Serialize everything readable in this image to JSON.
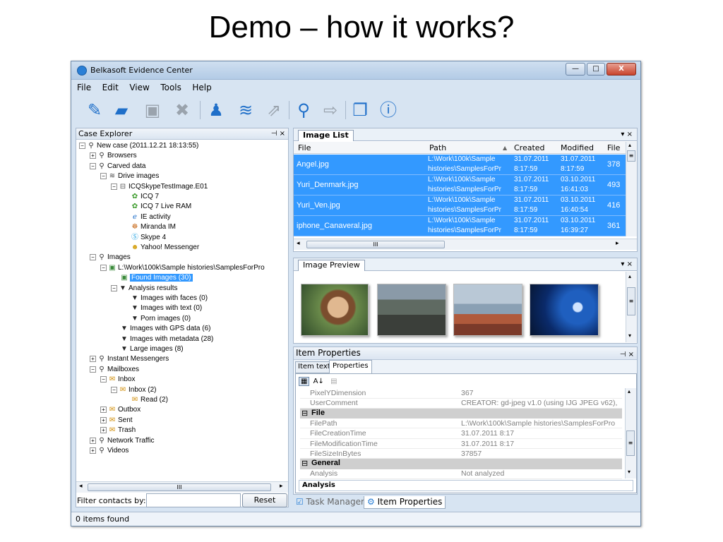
{
  "slide": {
    "title": "Demo – how it works?"
  },
  "window": {
    "title": "Belkasoft Evidence Center",
    "controls": {
      "minimize": "—",
      "maximize": "□",
      "close": "X"
    }
  },
  "menu": [
    "File",
    "Edit",
    "View",
    "Tools",
    "Help"
  ],
  "toolbar": {
    "icons": [
      "edit-icon",
      "open-folder-icon",
      "save-icon",
      "delete-icon",
      "user-icon",
      "layers-icon",
      "export-icon",
      "search-icon",
      "next-icon",
      "copy-icon",
      "info-icon"
    ]
  },
  "case_explorer": {
    "title": "Case Explorer",
    "pin": "⊣",
    "close": "×",
    "tree": [
      {
        "label": "New case (2011.12.21 18:13:55)",
        "level": 0,
        "exp": "−",
        "icon": "search-icon"
      },
      {
        "label": "Browsers",
        "level": 1,
        "exp": "+",
        "icon": "search-icon"
      },
      {
        "label": "Carved data",
        "level": 1,
        "exp": "−",
        "icon": "search-icon"
      },
      {
        "label": "Drive images",
        "level": 2,
        "exp": "−",
        "icon": "layers-icon"
      },
      {
        "label": "ICQSkypeTestImage.E01",
        "level": 3,
        "exp": "−",
        "icon": "disk-icon"
      },
      {
        "label": "ICQ 7",
        "level": 4,
        "exp": "",
        "icon": "icq-icon"
      },
      {
        "label": "ICQ 7 Live RAM",
        "level": 4,
        "exp": "",
        "icon": "icq-icon"
      },
      {
        "label": "IE activity",
        "level": 4,
        "exp": "",
        "icon": "ie-icon"
      },
      {
        "label": "Miranda IM",
        "level": 4,
        "exp": "",
        "icon": "miranda-icon"
      },
      {
        "label": "Skype 4",
        "level": 4,
        "exp": "",
        "icon": "skype-icon"
      },
      {
        "label": "Yahoo! Messenger",
        "level": 4,
        "exp": "",
        "icon": "yahoo-icon"
      },
      {
        "label": "Images",
        "level": 1,
        "exp": "−",
        "icon": "search-icon"
      },
      {
        "label": "L:\\Work\\100k\\Sample histories\\SamplesForPro",
        "level": 2,
        "exp": "−",
        "icon": "image-folder-icon"
      },
      {
        "label": "Found Images (30)",
        "level": 3,
        "exp": "",
        "icon": "image-icon",
        "selected": true
      },
      {
        "label": "Analysis results",
        "level": 3,
        "exp": "−",
        "icon": "filter-icon"
      },
      {
        "label": "Images with faces (0)",
        "level": 4,
        "exp": "",
        "icon": "filter-icon"
      },
      {
        "label": "Images with text (0)",
        "level": 4,
        "exp": "",
        "icon": "filter-icon"
      },
      {
        "label": "Porn images (0)",
        "level": 4,
        "exp": "",
        "icon": "filter-icon"
      },
      {
        "label": "Images with GPS data (6)",
        "level": 3,
        "exp": "",
        "icon": "filter-icon"
      },
      {
        "label": "Images with metadata (28)",
        "level": 3,
        "exp": "",
        "icon": "filter-icon"
      },
      {
        "label": "Large images (8)",
        "level": 3,
        "exp": "",
        "icon": "filter-icon"
      },
      {
        "label": "Instant Messengers",
        "level": 1,
        "exp": "+",
        "icon": "search-icon"
      },
      {
        "label": "Mailboxes",
        "level": 1,
        "exp": "−",
        "icon": "search-icon"
      },
      {
        "label": "Inbox",
        "level": 2,
        "exp": "−",
        "icon": "mail-icon"
      },
      {
        "label": "Inbox (2)",
        "level": 3,
        "exp": "−",
        "icon": "mail-icon"
      },
      {
        "label": "Read (2)",
        "level": 4,
        "exp": "",
        "icon": "mail-icon"
      },
      {
        "label": "Outbox",
        "level": 2,
        "exp": "+",
        "icon": "mail-icon"
      },
      {
        "label": "Sent",
        "level": 2,
        "exp": "+",
        "icon": "mail-icon"
      },
      {
        "label": "Trash",
        "level": 2,
        "exp": "+",
        "icon": "mail-icon"
      },
      {
        "label": "Network Traffic",
        "level": 1,
        "exp": "+",
        "icon": "search-icon"
      },
      {
        "label": "Videos",
        "level": 1,
        "exp": "+",
        "icon": "search-icon"
      }
    ],
    "scroll_grip": "III",
    "filter_label": "Filter contacts by:",
    "filter_value": "",
    "reset_label": "Reset"
  },
  "image_list": {
    "tab": "Image List",
    "controls": "▾ ×",
    "columns": [
      "File",
      "Path",
      "Created",
      "Modified",
      "File"
    ],
    "sort_arrow": "▲",
    "rows": [
      {
        "file": "Angel.jpg",
        "path1": "L:\\Work\\100k\\Sample",
        "path2": "histories\\SamplesForPr",
        "c1": "31.07.2011",
        "c2": "8:17:59",
        "m1": "31.07.2011",
        "m2": "8:17:59",
        "size": "378"
      },
      {
        "file": "Yuri_Denmark.jpg",
        "path1": "L:\\Work\\100k\\Sample",
        "path2": "histories\\SamplesForPr",
        "c1": "31.07.2011",
        "c2": "8:17:59",
        "m1": "03.10.2011",
        "m2": "16:41:03",
        "size": "493"
      },
      {
        "file": "Yuri_Ven.jpg",
        "path1": "L:\\Work\\100k\\Sample",
        "path2": "histories\\SamplesForPr",
        "c1": "31.07.2011",
        "c2": "8:17:59",
        "m1": "03.10.2011",
        "m2": "16:40:54",
        "size": "416"
      },
      {
        "file": "iphone_Canaveral.jpg",
        "path1": "L:\\Work\\100k\\Sample",
        "path2": "histories\\SamplesForPr",
        "c1": "31.07.2011",
        "c2": "8:17:59",
        "m1": "03.10.2011",
        "m2": "16:39:27",
        "size": "361"
      }
    ],
    "scroll_grip": "III"
  },
  "image_preview": {
    "tab": "Image Preview",
    "controls": "▾ ×"
  },
  "item_properties": {
    "title": "Item Properties",
    "pin": "⊣",
    "close": "×",
    "tabs": [
      "Item text",
      "Properties"
    ],
    "sort_icon": "↓",
    "sort_label": "A",
    "rows": [
      {
        "type": "row",
        "key": "PixelYDimension",
        "value": "367"
      },
      {
        "type": "row",
        "key": "UserComment",
        "value": "CREATOR: gd-jpeg v1.0 (using IJG JPEG v62),"
      },
      {
        "type": "cat",
        "key": "File",
        "mark": "⊟"
      },
      {
        "type": "row",
        "key": "FilePath",
        "value": "L:\\Work\\100k\\Sample histories\\SamplesForPro"
      },
      {
        "type": "row",
        "key": "FileCreationTime",
        "value": "31.07.2011 8:17"
      },
      {
        "type": "row",
        "key": "FileModificationTime",
        "value": "31.07.2011 8:17"
      },
      {
        "type": "row",
        "key": "FileSizeInBytes",
        "value": "37857"
      },
      {
        "type": "cat",
        "key": "General",
        "mark": "⊟"
      },
      {
        "type": "row",
        "key": "Analysis",
        "value": "Not analyzed"
      }
    ],
    "footer": "Analysis"
  },
  "bottom_tabs": [
    {
      "label": "Task Manager",
      "icon": "task-manager-icon"
    },
    {
      "label": "Item Properties",
      "icon": "properties-icon"
    }
  ],
  "status": {
    "text": "0 items found"
  }
}
